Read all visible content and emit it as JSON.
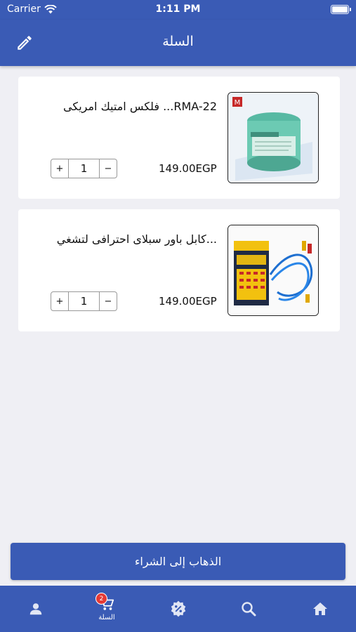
{
  "status_bar": {
    "carrier": "Carrier",
    "time": "1:11 PM"
  },
  "header": {
    "title": "السلة",
    "edit_icon": "pencil-icon"
  },
  "cart": {
    "items": [
      {
        "name": "فلكس امتيك امريكى ...RMA-22",
        "price": "149.00EGP",
        "quantity": "1",
        "plus": "+",
        "minus": "−"
      },
      {
        "name": "كابل باور سبلاى احترافى لتشغي...",
        "price": "149.00EGP",
        "quantity": "1",
        "plus": "+",
        "minus": "−"
      }
    ]
  },
  "checkout_label": "الذهاب إلى الشراء",
  "tabbar": {
    "cart_label": "السلة",
    "cart_badge": "2",
    "tabs": [
      "profile-icon",
      "cart-icon",
      "offers-icon",
      "search-icon",
      "home-icon"
    ]
  },
  "colors": {
    "primary": "#3a5bb5",
    "background": "#efeff4",
    "badge": "#e53935"
  }
}
